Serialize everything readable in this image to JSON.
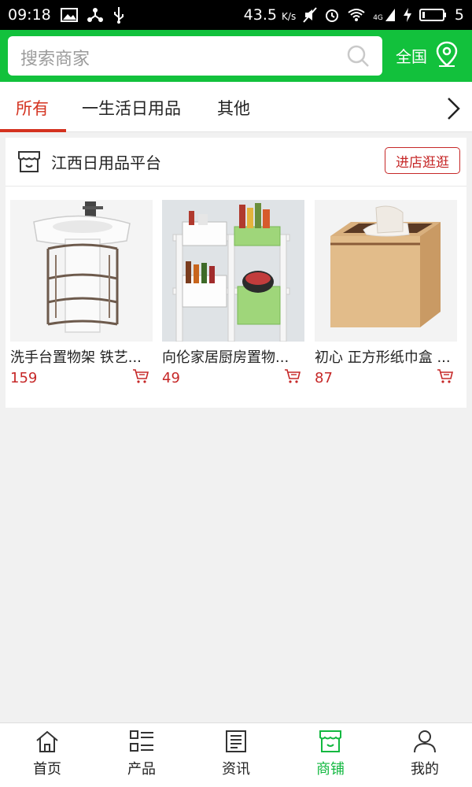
{
  "status_bar": {
    "time": "09:18",
    "speed": "43.5",
    "speed_unit": "K/s",
    "network": "4G",
    "battery": "5"
  },
  "search": {
    "placeholder": "搜索商家",
    "region_label": "全国"
  },
  "tabs": [
    {
      "label": "所有",
      "active": true
    },
    {
      "label": "一生活日用品",
      "active": false
    },
    {
      "label": "其他",
      "active": false
    }
  ],
  "store": {
    "name": "江西日用品平台",
    "visit_button": "进店逛逛",
    "products": [
      {
        "name": "洗手台置物架 铁艺...",
        "price": "159"
      },
      {
        "name": "向伦家居厨房置物...",
        "price": "49"
      },
      {
        "name": "初心 正方形纸巾盒 ...",
        "price": "87"
      }
    ]
  },
  "bottom_nav": [
    {
      "label": "首页",
      "icon": "home-icon",
      "active": false
    },
    {
      "label": "产品",
      "icon": "list-icon",
      "active": false
    },
    {
      "label": "资讯",
      "icon": "news-icon",
      "active": false
    },
    {
      "label": "商铺",
      "icon": "store-icon",
      "active": true
    },
    {
      "label": "我的",
      "icon": "user-icon",
      "active": false
    }
  ],
  "colors": {
    "brand_green": "#12c13c",
    "accent_red": "#d4321f",
    "price_red": "#c62828"
  }
}
